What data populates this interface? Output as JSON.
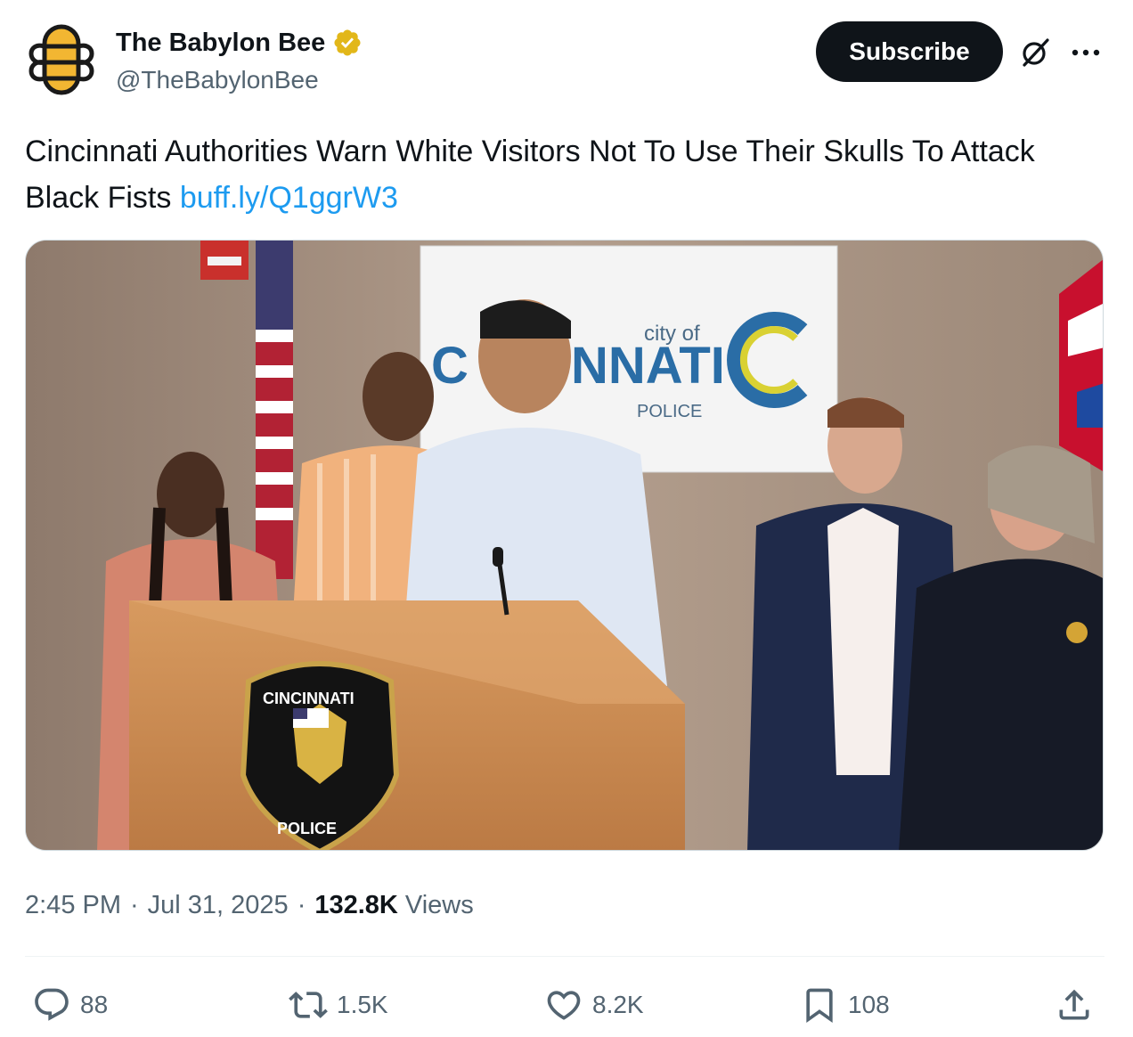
{
  "account": {
    "display_name": "The Babylon Bee",
    "handle": "@TheBabylonBee",
    "avatar_icon": "babylon-bee-logo",
    "verified_icon": "verified-badge-gold",
    "verified_color": "#e2b719"
  },
  "header_actions": {
    "subscribe_label": "Subscribe",
    "grok_icon": "grok-icon",
    "more_icon": "more-horizontal-icon"
  },
  "tweet": {
    "text": "Cincinnati Authorities Warn White Visitors Not To Use Their Skulls To Attack Black Fists ",
    "link_text": "buff.ly/Q1ggrW3",
    "link_color": "#1d9bf0"
  },
  "media": {
    "sign_city_of": "city of",
    "sign_name_part1": "C",
    "sign_name_part2": "NNATI",
    "sign_police": "POLICE",
    "podium_badge_top": "CINCINNATI",
    "podium_badge_bottom": "POLICE"
  },
  "meta": {
    "time": "2:45 PM",
    "separator": "·",
    "date": "Jul 31, 2025",
    "views_count": "132.8K",
    "views_label": "Views"
  },
  "actions": {
    "replies": "88",
    "reposts": "1.5K",
    "likes": "8.2K",
    "bookmarks": "108",
    "icons": [
      "reply-icon",
      "repost-icon",
      "like-icon",
      "bookmark-icon",
      "share-icon"
    ],
    "icon_color": "#536471"
  }
}
